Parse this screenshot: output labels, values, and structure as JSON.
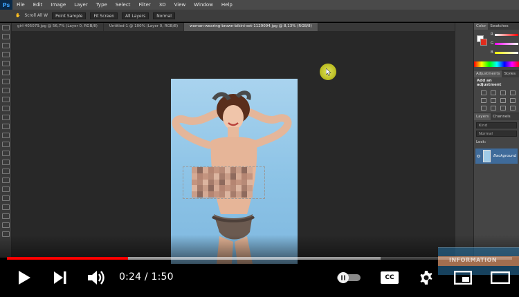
{
  "photoshop": {
    "logo": "Ps",
    "menu": [
      "File",
      "Edit",
      "Image",
      "Layer",
      "Type",
      "Select",
      "Filter",
      "3D",
      "View",
      "Window",
      "Help"
    ],
    "options": {
      "scroll_all": "Scroll All W",
      "sample": "Point Sample",
      "zoom": "Fit Screen",
      "layers": "All Layers",
      "mode": "Normal"
    },
    "tabs": [
      {
        "label": "girl-405079.jpg @ 56,7% (Layer 0, RGB/8)",
        "active": false
      },
      {
        "label": "Untitled-1 @ 100% (Layer 0, RGB/8)",
        "active": false
      },
      {
        "label": "woman-wearing-brown-bikini-set-1129094.jpg @ 8,13% (RGB/8)",
        "active": true
      }
    ],
    "panels": {
      "color_tabs": [
        "Color",
        "Swatches"
      ],
      "channels": [
        "R",
        "G",
        "B"
      ],
      "adjust_tabs": [
        "Adjustments",
        "Styles"
      ],
      "adjust_title": "Add an adjustment",
      "layer_tabs": [
        "Layers",
        "Channels"
      ],
      "layer_kind": "Kind",
      "blend_mode": "Normal",
      "lock_label": "Lock:",
      "layer_name": "Background"
    },
    "colors": {
      "foreground": "#ffffff",
      "background": "#e02b1c",
      "selection_layer": "#3f6b9a"
    }
  },
  "player": {
    "time_current": "0:24",
    "time_total": "1:50",
    "progress_fraction": 0.24,
    "buffer_fraction": 0.74,
    "accent": "#ff0000",
    "cc_label": "CC",
    "watermark": "INFORMATION",
    "icons": [
      "play-icon",
      "next-icon",
      "volume-icon",
      "autoplay-toggle",
      "subtitles-icon",
      "settings-icon",
      "miniplayer-icon",
      "theater-icon"
    ]
  }
}
